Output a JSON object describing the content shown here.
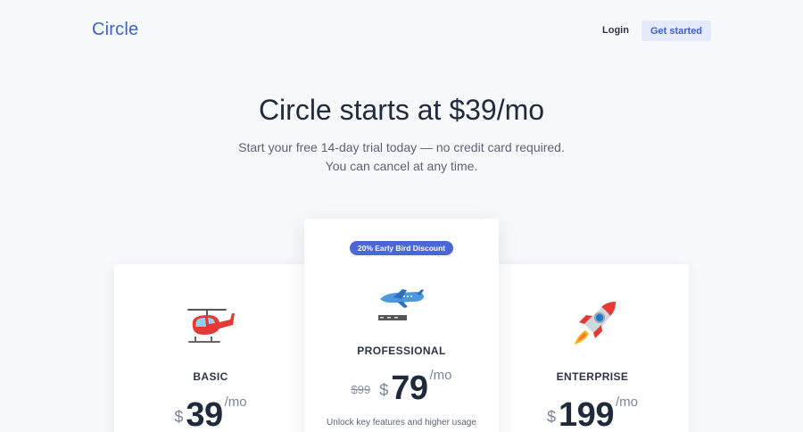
{
  "header": {
    "logo": "Circle",
    "login_label": "Login",
    "cta_label": "Get started"
  },
  "hero": {
    "title": "Circle starts at $39/mo",
    "subtitle_line1": "Start your free 14-day trial today — no credit card required.",
    "subtitle_line2": "You can cancel at any time."
  },
  "plans": [
    {
      "icon": "helicopter-icon",
      "name": "BASIC",
      "currency": "$",
      "price": "39",
      "period": "/mo"
    },
    {
      "icon": "airplane-icon",
      "name": "PROFESSIONAL",
      "badge": "20% Early Bird Discount",
      "old_price": "$99",
      "currency": "$",
      "price": "79",
      "period": "/mo",
      "description": "Unlock key features and higher usage"
    },
    {
      "icon": "rocket-icon",
      "name": "ENTERPRISE",
      "currency": "$",
      "price": "199",
      "period": "/mo"
    }
  ],
  "colors": {
    "brand": "#3e5fd0",
    "badge": "#4a67d8",
    "cta_bg": "#e4e9fb"
  }
}
